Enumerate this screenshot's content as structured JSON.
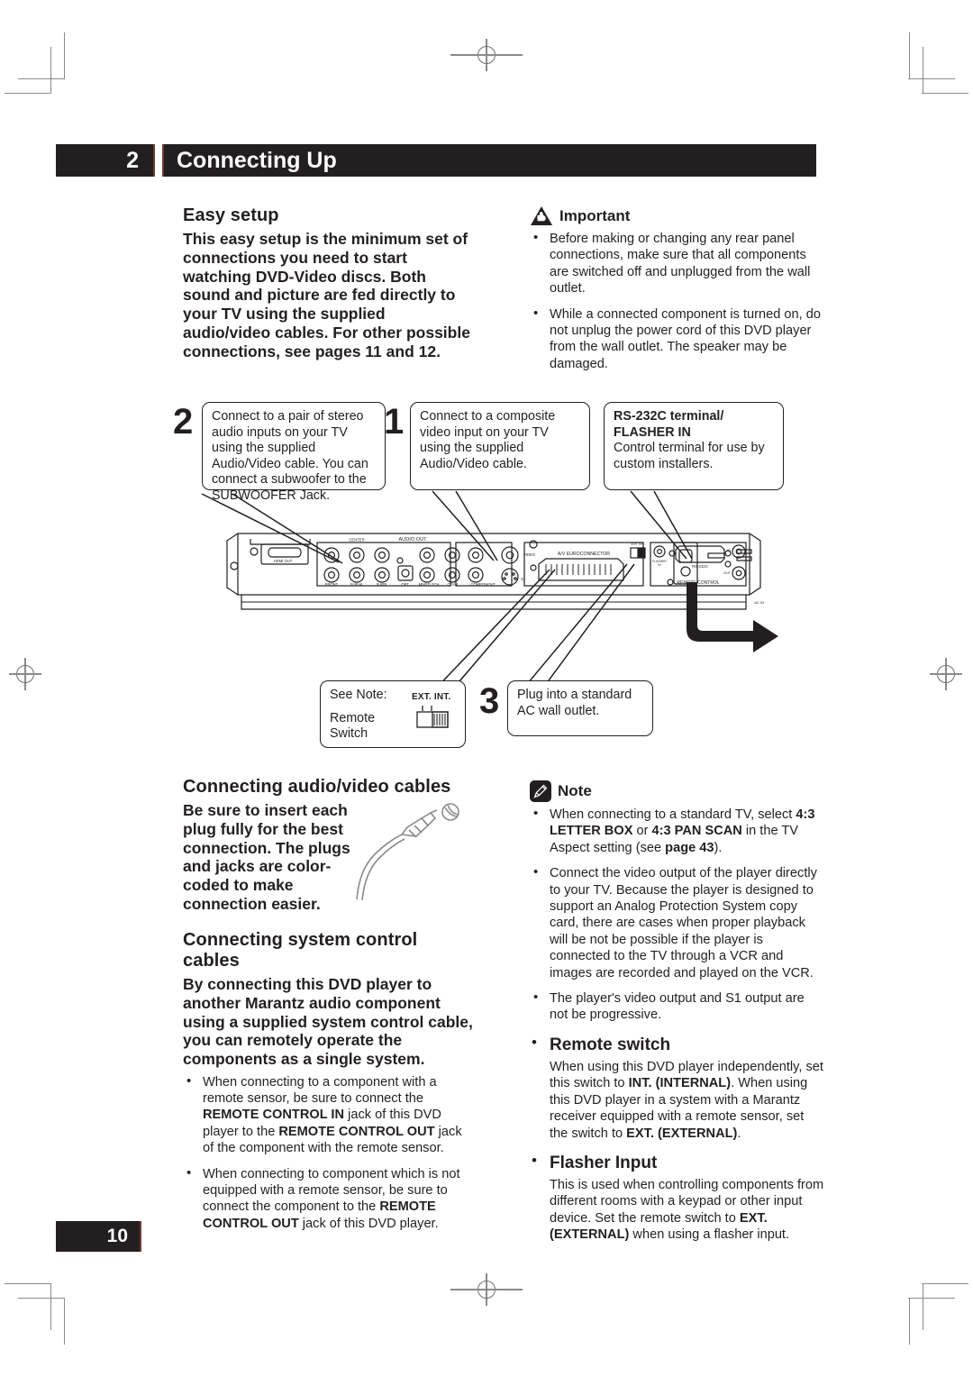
{
  "header": {
    "chapter_number": "2",
    "title": "Connecting Up"
  },
  "page_number": "10",
  "left_column": {
    "easy_setup_heading": "Easy setup",
    "easy_setup_body": "This easy setup is the minimum set of connections you need to start watching DVD-Video discs. Both sound and picture are fed directly to your TV using the supplied audio/video cables. For other possible connections, see pages 11 and 12.",
    "av_cables_heading": "Connecting audio/video cables",
    "av_cables_body": "Be sure to insert each plug fully for the best connection. The plugs and jacks are color-coded to make connection easier.",
    "system_control_heading": "Connecting system control cables",
    "system_control_body": "By connecting this DVD player to another Marantz audio component using a supplied system control cable, you can remotely operate the components as a single system.",
    "system_control_bullets": [
      "When connecting to a component with a remote sensor, be sure to connect the REMOTE CONTROL IN jack of this DVD player to the REMOTE CONTROL OUT jack of the component with the remote sensor.",
      "When connecting to component which is not equipped with a remote sensor, be sure to connect the component to the REMOTE CONTROL OUT jack of this DVD player."
    ]
  },
  "right_column": {
    "important_label": "Important",
    "important_icon": "warning-triangle-hand-icon",
    "important_bullets": [
      "Before making or changing any rear panel connections, make sure that all components are switched off and unplugged from the wall outlet.",
      "While a connected component is turned on, do not unplug the power cord of this DVD player from the wall outlet. The speaker may be damaged."
    ],
    "note_label": "Note",
    "note_icon": "pencil-icon",
    "note_bullets": [
      "When connecting to a standard TV, select 4:3 LETTER BOX or 4:3 PAN SCAN in the TV Aspect setting (see page 43).",
      "Connect the video output of the player directly to your TV.  Because the player is designed to support an Analog Protection System copy card, there are cases when proper playback will be not be possible if the player is connected to the TV through a VCR and images are recorded and played on the VCR.",
      "The player's video output and S1 output are not be progressive."
    ],
    "remote_switch_heading": "Remote switch",
    "remote_switch_body": "When using this DVD player independently, set this switch to INT. (INTERNAL). When using this DVD player in a system with a Marantz receiver equipped with a remote sensor, set the switch to EXT. (EXTERNAL).",
    "flasher_input_heading": "Flasher Input",
    "flasher_input_body": "This is used when controlling components from different rooms with a keypad or other input device. Set the remote switch to EXT. (EXTERNAL) when using a flasher input."
  },
  "diagram": {
    "callout_2_number": "2",
    "callout_2_text": "Connect to a pair of stereo audio inputs on your TV using the supplied Audio/Video cable. You can connect a subwoofer to the SUBWOOFER Jack.",
    "callout_1_number": "1",
    "callout_1_text": "Connect to a composite video input on your TV using the supplied Audio/Video cable.",
    "callout_rs232_title": "RS-232C terminal/",
    "callout_rs232_title2": "FLASHER IN",
    "callout_rs232_text": "Control terminal for use by custom installers.",
    "callout_note_line1": "See Note:",
    "callout_note_line2": "Remote Switch",
    "switch_label_ext": "EXT.",
    "switch_label_int": "INT.",
    "callout_3_number": "3",
    "callout_3_text": "Plug into a standard AC wall outlet.",
    "rear_panel_labels": {
      "hdmi": "HDMI OUT",
      "center": "CENTER",
      "audio_out": "AUDIO OUT",
      "front": "FRONT",
      "subw": "SUB W.",
      "surr": "SURR.",
      "opt": "OPT.",
      "mixed2ch": "MIXED 2CH",
      "coax": "COAX.",
      "component": "COMPONENT",
      "video": "VIDEO",
      "s1": "S1",
      "euro": "A/V EUROCONNECTOR",
      "extint": "EXT. INT.",
      "flasher": "FLASHER IN",
      "rs232c": "RS-232C",
      "remote_control": "REMOTE CONTROL",
      "remote_in": "IN",
      "remote_out": "OUT",
      "ac_in": "AC IN"
    }
  },
  "colors": {
    "ink": "#231f20",
    "bar_edge": "#6d3b34",
    "paper": "#ffffff",
    "crop_mark": "#8a8a8a"
  }
}
